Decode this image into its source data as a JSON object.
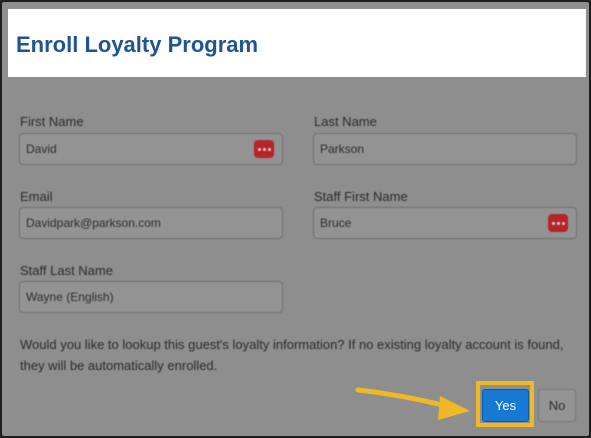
{
  "header": {
    "title": "Enroll Loyalty Program"
  },
  "form": {
    "first_name": {
      "label": "First Name",
      "value": "David"
    },
    "last_name": {
      "label": "Last Name",
      "value": "Parkson"
    },
    "email": {
      "label": "Email",
      "value": "Davidpark@parkson.com"
    },
    "staff_first_name": {
      "label": "Staff First Name",
      "value": "Bruce"
    },
    "staff_last_name": {
      "label": "Staff Last Name",
      "value": "Wayne (English)"
    }
  },
  "prompt": {
    "text": "Would you like to lookup this guest's loyalty information? If no existing loyalty account is found, they will be automatically enrolled."
  },
  "actions": {
    "yes_label": "Yes",
    "no_label": "No"
  },
  "colors": {
    "title": "#1f5592",
    "yes_button": "#1679d4",
    "highlight": "#efb826",
    "overlay": "#8e8e8e",
    "badge": "#b4242a"
  },
  "icons": {
    "password_manager": "more-dots-icon",
    "pointer": "arrow-icon"
  }
}
